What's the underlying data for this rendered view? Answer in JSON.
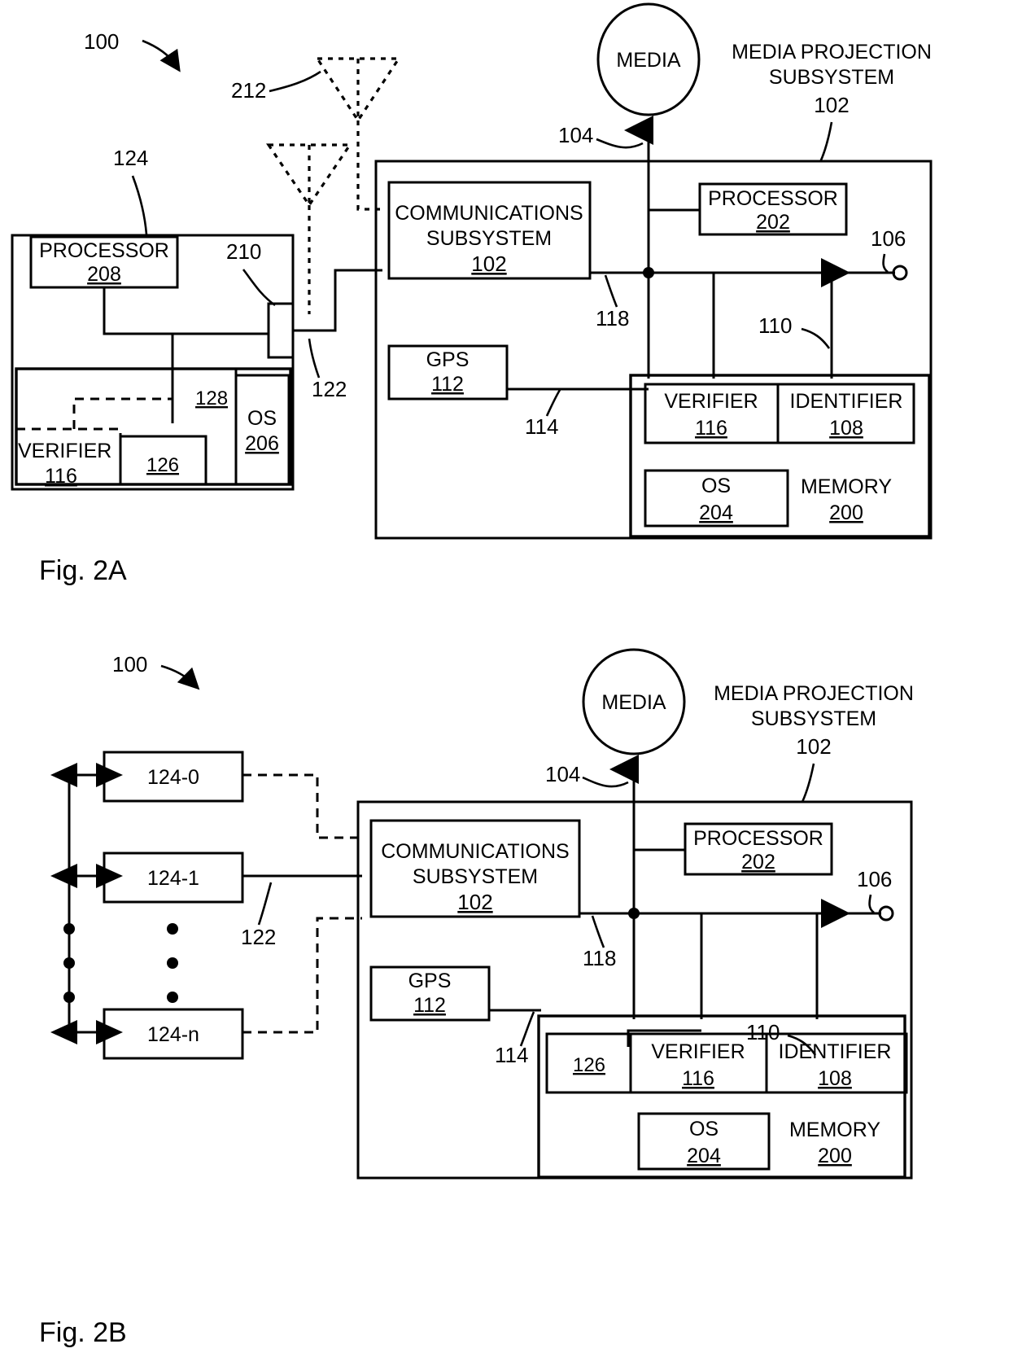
{
  "document": {
    "type": "patent-figure-sheet",
    "figures": [
      {
        "id": "fig2a",
        "caption": "Fig. 2A",
        "system_ref": "100",
        "nodes": {
          "media_label": "MEDIA",
          "media_arrow_ref": "104",
          "projection_title_line1": "MEDIA PROJECTION",
          "projection_title_line2": "SUBSYSTEM",
          "projection_ref": "102",
          "comms_line1": "COMMUNICATIONS",
          "comms_line2": "SUBSYSTEM",
          "comms_ref": "102",
          "processor_label": "PROCESSOR",
          "processor_ref": "202",
          "gps_label": "GPS",
          "gps_ref": "112",
          "verifier_label": "VERIFIER",
          "verifier_ref": "116",
          "identifier_label": "IDENTIFIER",
          "identifier_ref": "108",
          "os_label": "OS",
          "os_ref": "204",
          "memory_label": "MEMORY",
          "memory_ref": "200",
          "device_ref": "124",
          "device_processor_label": "PROCESSOR",
          "device_processor_ref": "208",
          "device_os_label": "OS",
          "device_os_ref": "206",
          "device_mem_ref": "128",
          "device_sub_ref": "126",
          "device_verifier_label": "VERIFIER",
          "device_verifier_ref": "116",
          "antenna_ref": "212",
          "antenna_port_ref": "210",
          "link_ref": "122",
          "bus_ref": "118",
          "gps_link_ref": "114",
          "mem_bus_ref": "110",
          "input_ref": "106"
        }
      },
      {
        "id": "fig2b",
        "caption": "Fig. 2B",
        "system_ref": "100",
        "nodes": {
          "media_label": "MEDIA",
          "media_arrow_ref": "104",
          "projection_title_line1": "MEDIA PROJECTION",
          "projection_title_line2": "SUBSYSTEM",
          "projection_ref": "102",
          "comms_line1": "COMMUNICATIONS",
          "comms_line2": "SUBSYSTEM",
          "comms_ref": "102",
          "processor_label": "PROCESSOR",
          "processor_ref": "202",
          "gps_label": "GPS",
          "gps_ref": "112",
          "sub_ref": "126",
          "verifier_label": "VERIFIER",
          "verifier_ref": "116",
          "identifier_label": "IDENTIFIER",
          "identifier_ref": "108",
          "os_label": "OS",
          "os_ref": "204",
          "memory_label": "MEMORY",
          "memory_ref": "200",
          "device_0": "124-0",
          "device_1": "124-1",
          "device_n": "124-n",
          "link_ref": "122",
          "bus_ref": "118",
          "gps_link_ref": "114",
          "mem_bus_ref": "110",
          "input_ref": "106"
        }
      }
    ]
  }
}
